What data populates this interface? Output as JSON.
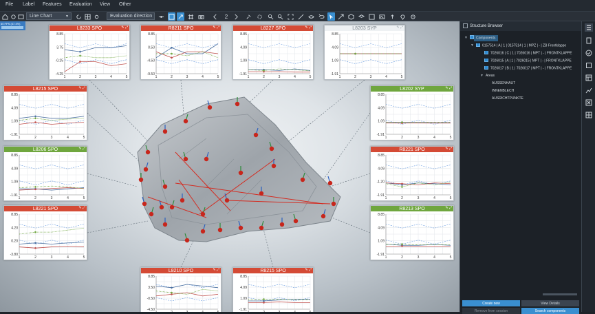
{
  "menu": [
    "File",
    "Label",
    "Features",
    "Evaluation",
    "View",
    "Other"
  ],
  "toolbar": {
    "chart_type": "Line Chart",
    "direction": "Evaluation direction",
    "page": "2"
  },
  "fps_label": "60 FPS (37.4%)",
  "panels": [
    {
      "id": "L8233",
      "title": "L8233 SPO",
      "color": "red",
      "yticks": [
        "8.85",
        "3.75",
        "-0.25",
        "-4.25"
      ],
      "xticks": [
        "1",
        "2",
        "3",
        "4",
        "5"
      ]
    },
    {
      "id": "R8211",
      "title": "R8211 SPO",
      "color": "red",
      "yticks": [
        "8.85",
        "0.50",
        "-4.50",
        "-9.50"
      ],
      "xticks": [
        "1",
        "2",
        "3",
        "4",
        "5"
      ]
    },
    {
      "id": "L8227",
      "title": "L8227 SPO",
      "color": "red",
      "yticks": [
        "8.85",
        "4.09",
        "1.09",
        "-1.91"
      ],
      "xticks": [
        "1",
        "2",
        "3",
        "4",
        "5"
      ]
    },
    {
      "id": "L8203",
      "title": "L8203 SYP",
      "color": "gray",
      "yticks": [
        "8.85",
        "4.09",
        "1.09",
        "-1.91"
      ],
      "xticks": [
        "1",
        "2",
        "3",
        "4",
        "5"
      ]
    },
    {
      "id": "L8215",
      "title": "L8215 SPO",
      "color": "red",
      "yticks": [
        "8.85",
        "4.09",
        "1.09",
        "-1.91"
      ],
      "xticks": [
        "1",
        "2",
        "3",
        "4",
        "5"
      ]
    },
    {
      "id": "L8202",
      "title": "L8202 SYP",
      "color": "green",
      "yticks": [
        "8.85",
        "4.09",
        "1.09",
        "-1.91"
      ],
      "xticks": [
        "1",
        "2",
        "3",
        "4",
        "5"
      ]
    },
    {
      "id": "L8206",
      "title": "L8206 SPO",
      "color": "green",
      "yticks": [
        "8.85",
        "4.09",
        "1.09",
        "-1.91"
      ],
      "xticks": [
        "1",
        "2",
        "3",
        "4",
        "5"
      ]
    },
    {
      "id": "R8221",
      "title": "R8221 SPO",
      "color": "red",
      "yticks": [
        "8.85",
        "4.09",
        "-1.20",
        "-1.91"
      ],
      "xticks": [
        "1",
        "2",
        "3",
        "4",
        "5"
      ]
    },
    {
      "id": "L8221",
      "title": "L8221 SPO",
      "color": "red",
      "yticks": [
        "8.85",
        "4.20",
        "0.20",
        "-3.80"
      ],
      "xticks": [
        "1",
        "2",
        "3",
        "4",
        "5"
      ]
    },
    {
      "id": "R8213",
      "title": "R8213 SPO",
      "color": "green",
      "yticks": [
        "8.85",
        "4.09",
        "1.09",
        "-1.91"
      ],
      "xticks": [
        "1",
        "2",
        "3",
        "4",
        "5"
      ]
    },
    {
      "id": "L8210",
      "title": "L8210 SPO",
      "color": "red",
      "yticks": [
        "8.85",
        "3.50",
        "-0.50",
        "-4.50"
      ],
      "xticks": [
        "1",
        "2",
        "3",
        "4",
        "5"
      ]
    },
    {
      "id": "R8215",
      "title": "R8215 SPO",
      "color": "red",
      "yticks": [
        "8.85",
        "4.09",
        "1.09",
        "-1.91"
      ],
      "xticks": [
        "1",
        "2",
        "3",
        "4",
        "5"
      ]
    }
  ],
  "browser": {
    "title": "Structure Browser",
    "root": "Components",
    "component": "0157514 | A | 1 | 0157514 | 1 | MPZ | - | ZB Frontklappe",
    "children": [
      "7026016 | C | 1 | 7026016 | MPT | - | FRONTKLAPPE",
      "7026015 | A | 1 | 7026015 | MPT | - | FRONTKLAPPE",
      "7026017 | B | 1 | 7026017 | MPT | - | FRONTKLAPPE"
    ],
    "areas_label": "Areas",
    "areas": [
      "AUSSENHAUT",
      "INNENBLECH",
      "AUSRICHTPUNKTE"
    ],
    "buttons": {
      "create": "Create new",
      "view": "View Details",
      "remove": "Remove from session",
      "search": "Search components"
    }
  },
  "colors": {
    "accent": "#3a8fd0",
    "red": "#d44a35",
    "green": "#6fa63e"
  }
}
